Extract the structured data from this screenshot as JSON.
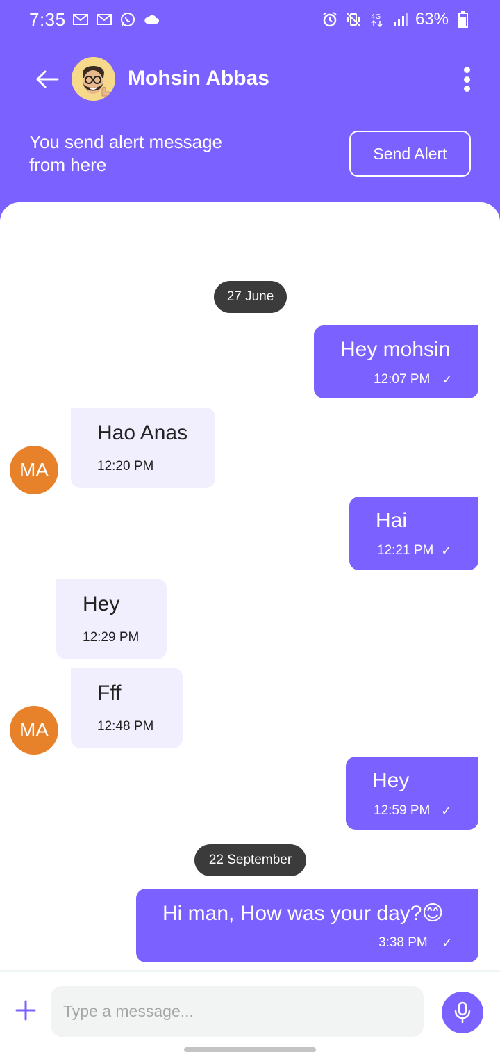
{
  "status_bar": {
    "time": "7:35",
    "battery": "63%",
    "icons": [
      "gmail-icon",
      "gmail-icon",
      "whatsapp-icon",
      "cloud-icon",
      "alarm-icon",
      "vibrate-icon",
      "4g-icon",
      "signal-icon",
      "battery-icon"
    ]
  },
  "header": {
    "contact_name": "Mohsin Abbas",
    "alert_text": "You send alert message from here",
    "alert_button": "Send Alert"
  },
  "colors": {
    "accent": "#7B61FF",
    "incoming_bubble": "#F1EFFE",
    "avatar_orange": "#E8822A",
    "date_pill": "#3b3b3b"
  },
  "chat": {
    "dates": [
      "27 June",
      "22 September"
    ],
    "messages": [
      {
        "direction": "out",
        "text": "Hey mohsin",
        "time": "12:07 PM",
        "tick": "✓"
      },
      {
        "direction": "in",
        "avatar": "MA",
        "text": "Hao Anas",
        "time": "12:20 PM"
      },
      {
        "direction": "out",
        "text": "Hai",
        "time": "12:21 PM",
        "tick": "✓"
      },
      {
        "direction": "in",
        "text": "Hey",
        "time": "12:29 PM"
      },
      {
        "direction": "in",
        "avatar": "MA",
        "text": "Fff",
        "time": "12:48 PM"
      },
      {
        "direction": "out",
        "text": "Hey",
        "time": "12:59 PM",
        "tick": "✓"
      },
      {
        "direction": "out",
        "text": "Hi man, How was your day?",
        "emoji": "😊",
        "time": "3:38 PM",
        "tick": "✓"
      }
    ]
  },
  "composer": {
    "placeholder": "Type a message..."
  }
}
